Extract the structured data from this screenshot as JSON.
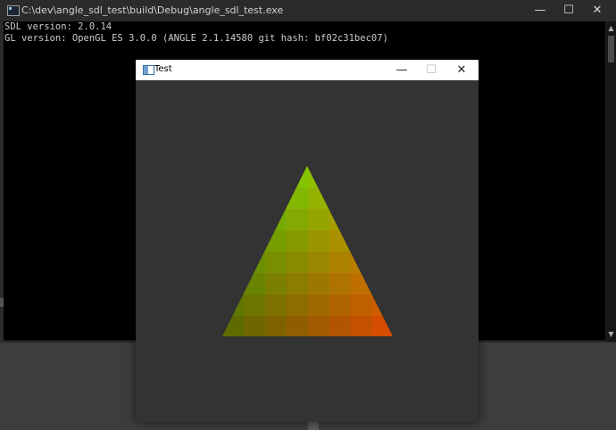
{
  "console": {
    "title": "C:\\dev\\angle_sdl_test\\build\\Debug\\angle_sdl_test.exe",
    "lines": [
      "SDL version: 2.0.14",
      "GL version: OpenGL ES 3.0.0 (ANGLE 2.1.14580 git hash: bf02c31bec07)"
    ],
    "controls": {
      "minimize": "—",
      "maximize": "☐",
      "close": "✕"
    }
  },
  "test_window": {
    "title": "Test",
    "controls": {
      "minimize": "—",
      "maximize": "☐",
      "close": "✕"
    },
    "triangle": {
      "clear_color": "#333333",
      "vertex_colors": {
        "top": "#88cc00",
        "bottom_left": "#556600",
        "bottom_right": "#dd4400"
      }
    }
  }
}
